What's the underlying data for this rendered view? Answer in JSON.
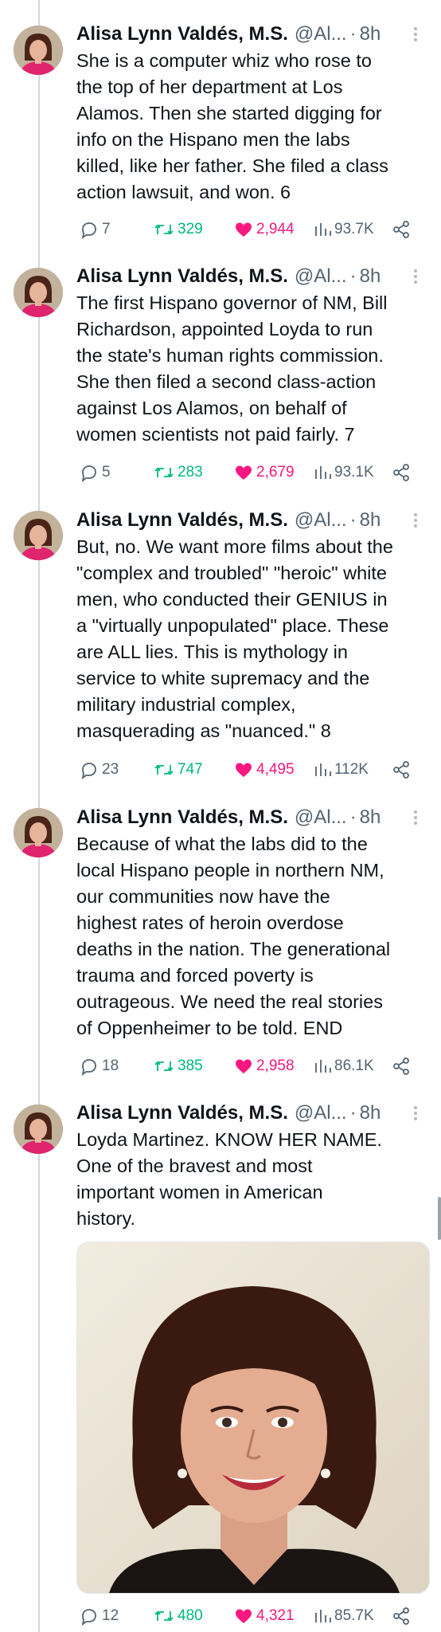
{
  "tweets": [
    {
      "name": "Alisa Lynn Valdés, M.S.",
      "handle": "@Al...",
      "time": "8h",
      "text": "She is a computer whiz who rose to\nthe top of her department at Los\nAlamos. Then she started digging for\ninfo on the Hispano men the labs\nkilled, like her father. She filed a class\naction lawsuit, and won. 6",
      "replies": "7",
      "retweets": "329",
      "likes": "2,944",
      "views": "93.7K"
    },
    {
      "name": "Alisa Lynn Valdés, M.S.",
      "handle": "@Al...",
      "time": "8h",
      "text": "The first Hispano governor of NM, Bill\nRichardson, appointed Loyda to run\nthe state's human rights commission.\nShe then filed a second class-action\nagainst Los Alamos, on behalf of\nwomen scientists not paid fairly. 7",
      "replies": "5",
      "retweets": "283",
      "likes": "2,679",
      "views": "93.1K"
    },
    {
      "name": "Alisa Lynn Valdés, M.S.",
      "handle": "@Al...",
      "time": "8h",
      "text": "But, no. We want more films about the\n\"complex and troubled\" \"heroic\" white\nmen, who conducted their GENIUS in\na \"virtually unpopulated\" place. These\nare ALL lies. This is mythology in\nservice to white supremacy and the\nmilitary industrial complex,\nmasquerading as \"nuanced.\" 8",
      "replies": "23",
      "retweets": "747",
      "likes": "4,495",
      "views": "112K"
    },
    {
      "name": "Alisa Lynn Valdés, M.S.",
      "handle": "@Al...",
      "time": "8h",
      "text": "Because of what the labs did to the\nlocal Hispano people in northern NM,\nour communities now have the\nhighest rates of heroin overdose\ndeaths in the nation. The generational\ntrauma and forced poverty is\noutrageous. We need the real stories\nof Oppenheimer to be told. END",
      "replies": "18",
      "retweets": "385",
      "likes": "2,958",
      "views": "86.1K"
    },
    {
      "name": "Alisa Lynn Valdés, M.S.",
      "handle": "@Al...",
      "time": "8h",
      "text": "Loyda Martinez. KNOW HER NAME.\nOne of the bravest and most\nimportant women in American\nhistory.",
      "replies": "12",
      "retweets": "480",
      "likes": "4,321",
      "views": "85.7K"
    }
  ],
  "photo_alt": "Photo of a smiling woman with dark shoulder-length hair",
  "colors": {
    "text": "#0f1419",
    "muted": "#536471",
    "retweet": "#00ba7c",
    "like": "#f91880",
    "thread": "#cfd9de"
  },
  "icons": [
    "reply-icon",
    "retweet-icon",
    "heart-icon",
    "views-icon",
    "share-icon",
    "more-icon"
  ]
}
